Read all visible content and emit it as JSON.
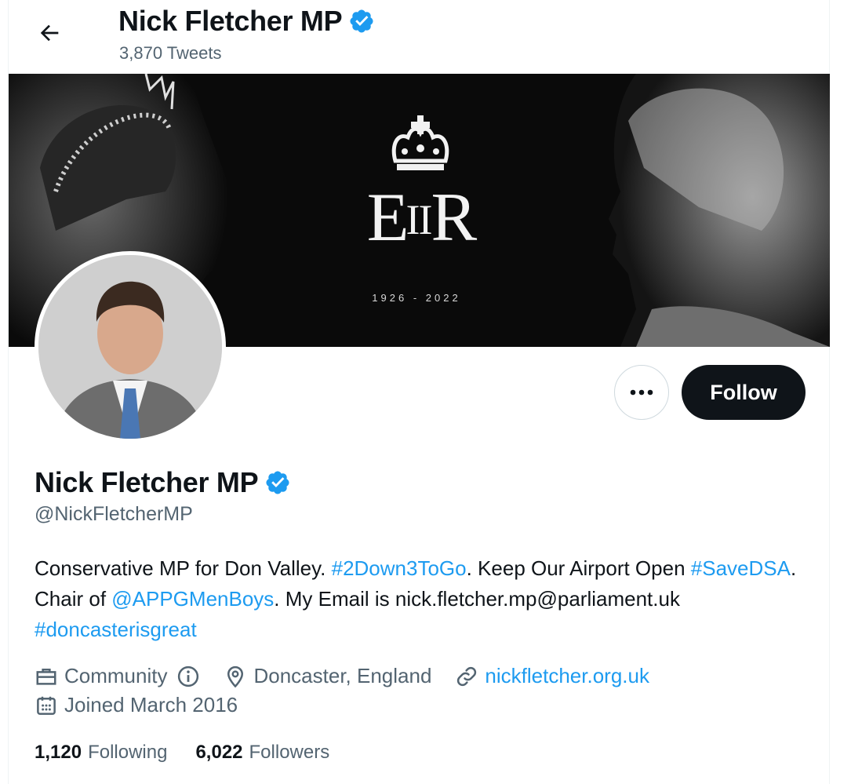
{
  "header": {
    "name": "Nick Fletcher MP",
    "tweet_count": "3,870 Tweets"
  },
  "banner": {
    "cipher_main": "E",
    "cipher_numeral": "II",
    "cipher_end": "R",
    "dates": "1926 - 2022"
  },
  "actions": {
    "more_icon": "more-horizontal-icon",
    "follow_label": "Follow"
  },
  "profile": {
    "name": "Nick Fletcher MP",
    "handle": "@NickFletcherMP",
    "bio": {
      "t1": "Conservative MP for Don Valley. ",
      "tag1": "#2Down3ToGo",
      "t2": ". Keep Our Airport Open ",
      "tag2": "#SaveDSA",
      "t3": ". Chair of ",
      "mention": "@APPGMenBoys",
      "t4": ". My Email is nick.fletcher.mp@parliament.uk ",
      "tag3": "#doncasterisgreat"
    },
    "category": "Community",
    "location": "Doncaster, England",
    "website": "nickfletcher.org.uk",
    "joined": "Joined March 2016"
  },
  "stats": {
    "following_count": "1,120",
    "following_label": "Following",
    "followers_count": "6,022",
    "followers_label": "Followers"
  },
  "colors": {
    "accent": "#1d9bf0",
    "text": "#0f1419",
    "secondary": "#536471"
  }
}
